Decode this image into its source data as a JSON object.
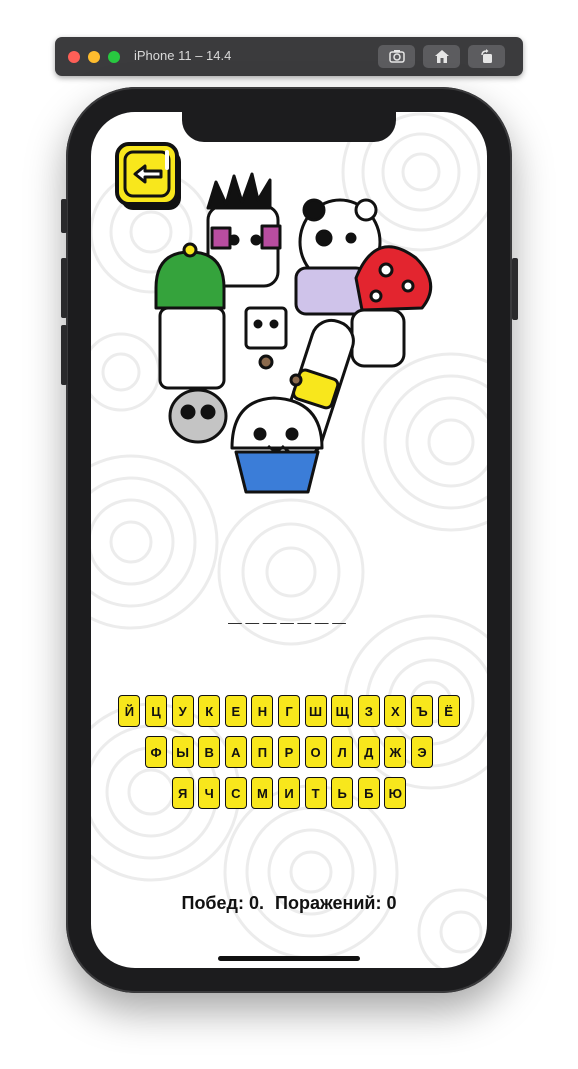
{
  "simulator": {
    "title": "iPhone 11 – 14.4",
    "buttons": [
      "screenshot-icon",
      "home-icon",
      "rotate-icon"
    ]
  },
  "game": {
    "back_icon": "arrow-left-icon",
    "word_mask": "_______",
    "keyboard": {
      "rows": [
        [
          "Й",
          "Ц",
          "У",
          "К",
          "Е",
          "Н",
          "Г",
          "Ш",
          "Щ",
          "З",
          "Х",
          "Ъ",
          "Ё"
        ],
        [
          "Ф",
          "Ы",
          "В",
          "А",
          "П",
          "Р",
          "О",
          "Л",
          "Д",
          "Ж",
          "Э"
        ],
        [
          "Я",
          "Ч",
          "С",
          "М",
          "И",
          "Т",
          "Ь",
          "Б",
          "Ю"
        ]
      ],
      "key_color": "#f8e71c"
    },
    "score": {
      "wins_label": "Побед: 0.",
      "losses_label": "Поражений: 0"
    }
  }
}
